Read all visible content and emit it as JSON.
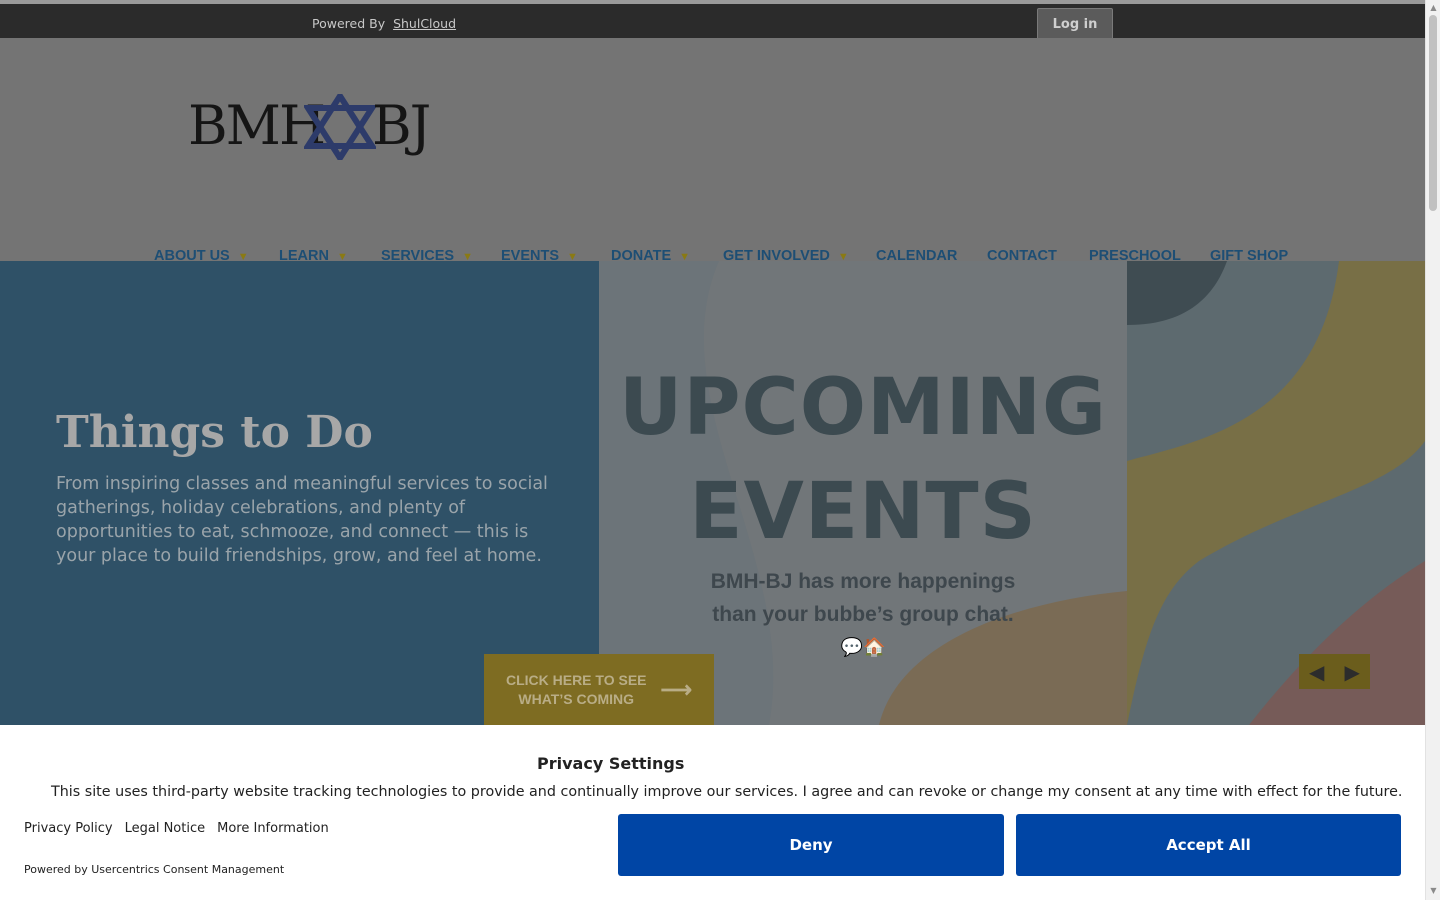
{
  "topbar": {
    "powered_prefix": "Powered By",
    "powered_link": "ShulCloud",
    "login_label": "Log in"
  },
  "logo": {
    "text_left": "BMH",
    "text_right": "BJ",
    "star": "✡"
  },
  "nav": {
    "items": [
      {
        "label": "ABOUT US",
        "caret": "▼"
      },
      {
        "label": "LEARN",
        "caret": "▼"
      },
      {
        "label": "SERVICES",
        "caret": "▼"
      },
      {
        "label": "EVENTS",
        "caret": "▼"
      },
      {
        "label": "DONATE",
        "caret": "▼"
      },
      {
        "label": "GET INVOLVED",
        "caret": "▼"
      },
      {
        "label": "CALENDAR"
      },
      {
        "label": "CONTACT"
      },
      {
        "label": "PRESCHOOL"
      },
      {
        "label": "GIFT SHOP"
      }
    ]
  },
  "hero": {
    "title": "Things to Do",
    "description": "From inspiring classes and meaningful services to social gatherings, holiday celebrations, and plenty of opportunities to eat, schmooze, and connect — this is your place to build friendships, grow, and feel at home.",
    "banner_line1": "UPCOMING",
    "banner_line2": "EVENTS",
    "banner_sub1": "BMH-BJ has more happenings",
    "banner_sub2": "than your bubbe’s group chat.",
    "banner_emoji": "💬🏠",
    "cta_line1": "CLICK HERE TO SEE",
    "cta_line2": "WHAT’S COMING",
    "cta_arrow": "⟶",
    "prev_arrow": "◀",
    "next_arrow": "▶"
  },
  "privacy": {
    "title": "Privacy Settings",
    "text": "This site uses third-party website tracking technologies to provide and continually improve our services. I agree and can revoke or change my consent at any time with effect for the future.",
    "links": [
      "Privacy Policy",
      "Legal Notice",
      "More Information"
    ],
    "powered": "Powered by Usercentrics Consent Management",
    "deny_label": "Deny",
    "accept_label": "Accept All"
  },
  "colors": {
    "accent_blue": "#0045a5",
    "nav_text": "#1d4e74",
    "hero_left_bg": "#2f5167",
    "cta_bg": "#7e6c22"
  }
}
